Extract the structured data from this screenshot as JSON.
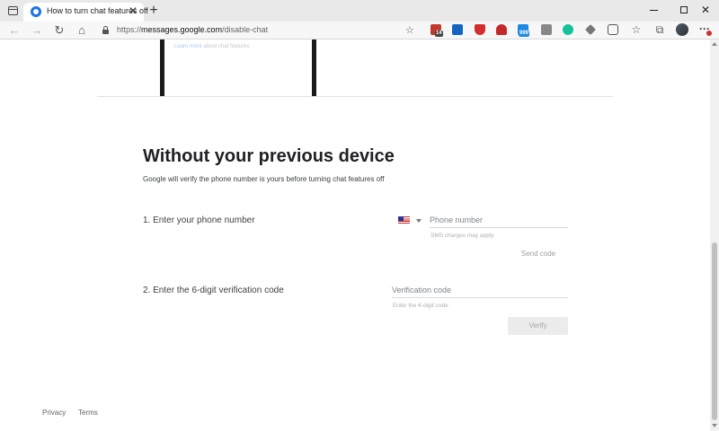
{
  "browser": {
    "tab_title": "How to turn chat features off",
    "tab_close": "✕",
    "new_tab": "+",
    "url_prefix": "https://",
    "url_host": "messages.google.com",
    "url_path": "/disable-chat",
    "window_controls": {
      "minimize": "",
      "maximize": "",
      "close": "✕"
    },
    "nav": {
      "back": "←",
      "forward": "→",
      "reload": "↻",
      "home": "⌂"
    },
    "extension_badges": [
      "14",
      "999"
    ],
    "icons": [
      "tab-actions-icon",
      "favicon-icon",
      "lock-icon",
      "favorite-star-icon",
      "favorites-icon",
      "collections-icon",
      "profile-avatar",
      "more-menu-icon"
    ]
  },
  "page": {
    "learn_more_link": "Learn more",
    "learn_more_suffix": " about chat features",
    "heading": "Without your previous device",
    "subtext": "Google will verify the phone number is yours before turning chat features off",
    "step1": {
      "label": "1. Enter your phone number",
      "country": "United States",
      "phone_placeholder": "Phone number",
      "helper": "SMS charges may apply",
      "send_code": "Send code"
    },
    "step2": {
      "label": "2. Enter the 6-digit verification code",
      "code_placeholder": "Verification code",
      "helper": "Enter the 6-digit code",
      "verify": "Verify"
    },
    "footer": {
      "privacy": "Privacy",
      "terms": "Terms"
    }
  },
  "colors": {
    "heading": "#202124",
    "body_text": "#3c4043",
    "disabled_button_bg": "#ececec",
    "link": "#a8c7fa",
    "favicon": "#1a73e8"
  }
}
